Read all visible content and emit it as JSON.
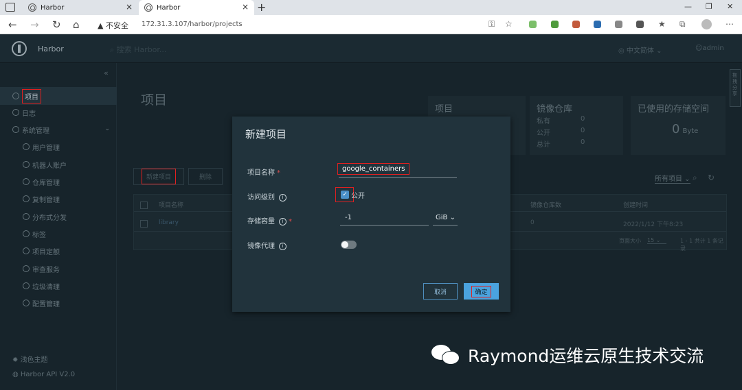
{
  "browser": {
    "tabs": [
      {
        "label": "Harbor"
      },
      {
        "label": "Harbor"
      }
    ],
    "security_label": "不安全",
    "url": "172.31.3.107/harbor/projects"
  },
  "header": {
    "brand": "Harbor",
    "search_placeholder": "搜索 Harbor...",
    "language": "中文简体",
    "user": "admin"
  },
  "sidebar": {
    "items": [
      {
        "label": "项目"
      },
      {
        "label": "日志"
      },
      {
        "label": "系统管理"
      },
      {
        "label": "用户管理"
      },
      {
        "label": "机器人账户"
      },
      {
        "label": "仓库管理"
      },
      {
        "label": "复制管理"
      },
      {
        "label": "分布式分发"
      },
      {
        "label": "标签"
      },
      {
        "label": "项目定额"
      },
      {
        "label": "审查服务"
      },
      {
        "label": "垃圾清理"
      },
      {
        "label": "配置管理"
      }
    ],
    "theme": "浅色主题",
    "api": "Harbor API V2.0"
  },
  "main": {
    "title": "项目",
    "stats": {
      "projects_title": "项目",
      "repos_title": "镜像仓库",
      "repo_rows": [
        {
          "label": "私有",
          "value": "0"
        },
        {
          "label": "公开",
          "value": "0"
        },
        {
          "label": "总计",
          "value": "0"
        }
      ],
      "storage_title": "已使用的存储空间",
      "storage_value": "0",
      "storage_unit": "Byte"
    },
    "new_project_btn": "新建项目",
    "delete_btn": "删除",
    "filter": "所有项目",
    "table": {
      "headers": [
        "项目名称",
        "镜像仓库数",
        "创建时间"
      ],
      "rows": [
        {
          "name": "library",
          "repos": "0",
          "created": "2022/1/12 下午8:23"
        }
      ],
      "page_size_label": "页面大小",
      "page_size": "15",
      "summary": "1 - 1 共计 1 条记录"
    }
  },
  "modal": {
    "title": "新建项目",
    "name_label": "项目名称",
    "name_value": "google_containers",
    "access_label": "访问级别",
    "public_label": "公开",
    "quota_label": "存储容量",
    "quota_value": "-1",
    "quota_unit": "GiB",
    "proxy_label": "镜像代理",
    "cancel": "取消",
    "ok": "确定"
  },
  "right_tab": "拖拽分享",
  "watermark": "Raymond运维云原生技术交流"
}
